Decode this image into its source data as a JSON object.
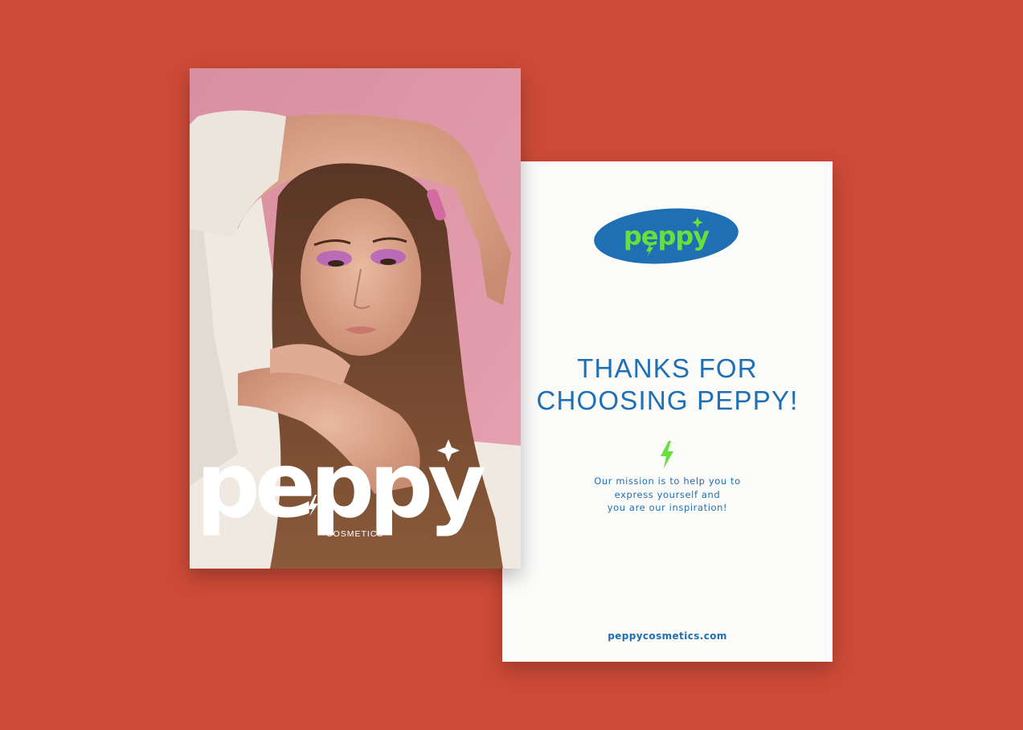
{
  "background_color": "#cc4a37",
  "front_card": {
    "brand_wordmark": "peppy",
    "subtitle": "COSMETICS",
    "photo": "portrait of a young woman with purple eyeshadow, arms raised over head, pink background",
    "wordmark_color": "#ffffff"
  },
  "back_card": {
    "logo": {
      "wordmark": "peppy",
      "oval_color": "#1f6fb4",
      "text_color": "#66e03a"
    },
    "heading_line1": "THANKS FOR",
    "heading_line2": "CHOOSING PEPPY!",
    "bolt_icon": "lightning-bolt-icon",
    "mission_line1": "Our mission is to help you to",
    "mission_line2": "express yourself and",
    "mission_line3": "you are our inspiration!",
    "website": "peppycosmetics.com",
    "text_color": "#1f6fb4",
    "accent_color": "#66e03a"
  }
}
